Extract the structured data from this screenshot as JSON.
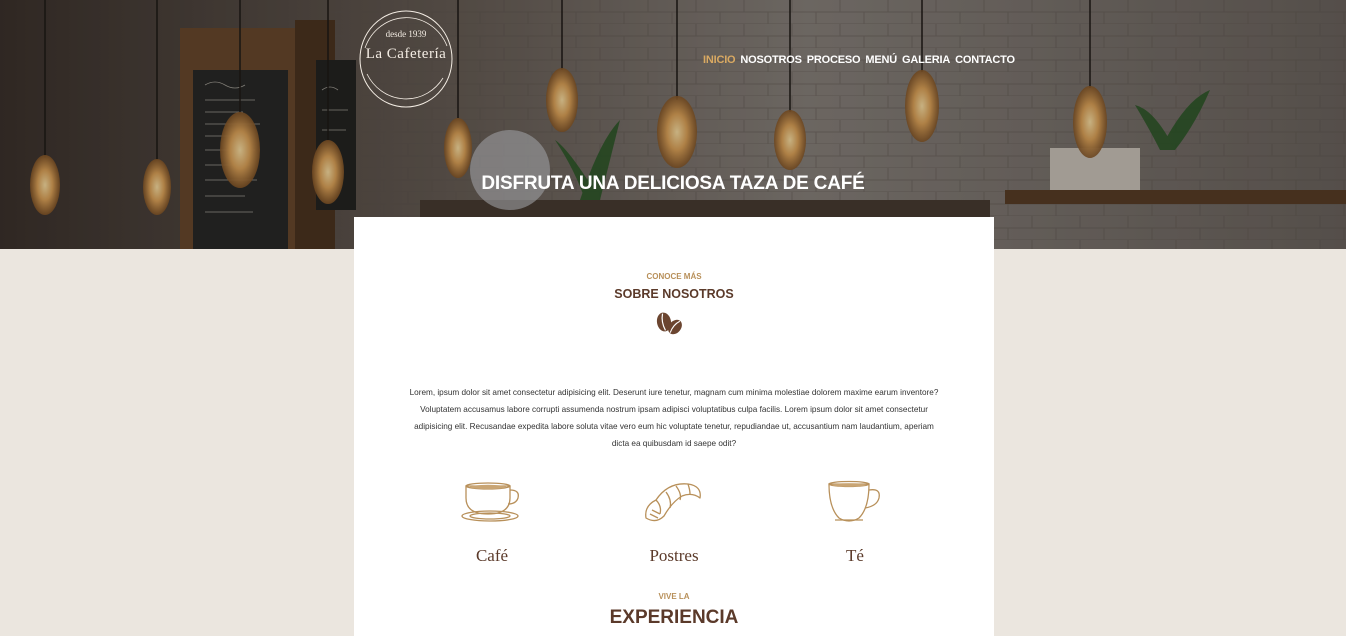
{
  "brand": {
    "since": "desde 1939",
    "name": "La Cafetería"
  },
  "nav": {
    "items": [
      {
        "label": "INICIO",
        "active": true
      },
      {
        "label": "NOSOTROS",
        "active": false
      },
      {
        "label": "PROCESO",
        "active": false
      },
      {
        "label": "MENÚ",
        "active": false
      },
      {
        "label": "GALERIA",
        "active": false
      },
      {
        "label": "CONTACTO",
        "active": false
      }
    ]
  },
  "hero": {
    "title": "DISFRUTA UNA DELICIOSA TAZA DE CAFÉ"
  },
  "about": {
    "eyebrow": "CONOCE MÁS",
    "title": "SOBRE NOSOTROS",
    "icon": "coffee-beans-icon",
    "body": "Lorem, ipsum dolor sit amet consectetur adipisicing elit. Deserunt iure tenetur, magnam cum minima molestiae dolorem maxime earum inventore? Voluptatem accusamus labore corrupti assumenda nostrum ipsam adipisci voluptatibus culpa facilis. Lorem ipsum dolor sit amet consectetur adipisicing elit. Recusandae expedita labore soluta vitae vero eum hic voluptate tenetur, repudiandae ut, accusantium nam laudantium, aperiam dicta ea quibusdam id saepe odit?"
  },
  "products": [
    {
      "label": "Café",
      "icon": "coffee-cup-icon"
    },
    {
      "label": "Postres",
      "icon": "croissant-icon"
    },
    {
      "label": "Té",
      "icon": "tea-cup-icon"
    }
  ],
  "experience": {
    "eyebrow": "VIVE LA",
    "title": "EXPERIENCIA"
  },
  "colors": {
    "accent": "#d9a962",
    "brown": "#5b3a2a",
    "gold": "#b8905a",
    "page_bg": "#ebe6df"
  }
}
